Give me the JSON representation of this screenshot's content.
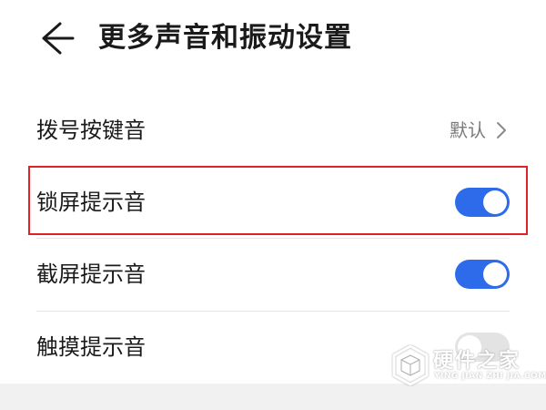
{
  "header": {
    "title": "更多声音和振动设置",
    "back_icon": "arrow-left-icon"
  },
  "settings": [
    {
      "label": "拨号按键音",
      "value": "默认",
      "control": "chevron-right-icon"
    },
    {
      "label": "锁屏提示音",
      "toggle": "on",
      "highlighted": true
    },
    {
      "label": "截屏提示音",
      "toggle": "on"
    },
    {
      "label": "触摸提示音",
      "toggle": "off"
    }
  ],
  "colors": {
    "toggle_on": "#2d6bea",
    "toggle_off": "#e3e3e3",
    "highlight_border": "#e0202a"
  },
  "watermark": {
    "title": "硬件之家",
    "subtitle": "YING JIAN ZHI JIA.COM",
    "logo_icon": "cube-logo-icon"
  }
}
